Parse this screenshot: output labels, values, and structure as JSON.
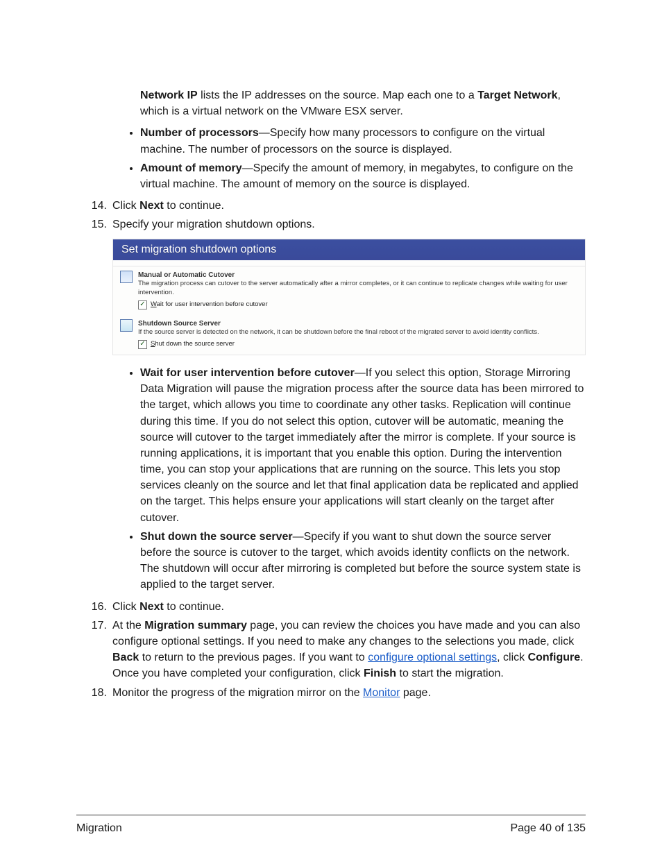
{
  "network_ip_para": {
    "b1": "Network IP",
    "t1": " lists the IP addresses on the source. Map each one to a ",
    "b2": "Target Network",
    "t2": ", which is a virtual network on the VMware ESX server."
  },
  "sub_bullets_top": {
    "nproc": {
      "b": "Number of processors",
      "t": "—Specify how many processors to configure on the virtual machine. The number of processors on the source is displayed."
    },
    "mem": {
      "b": "Amount of memory",
      "t": "—Specify the amount of memory, in megabytes, to configure on the virtual machine. The amount of memory on the source is displayed."
    }
  },
  "steps": {
    "s14": {
      "num": "14.",
      "pre": "Click ",
      "b": "Next",
      "post": " to continue."
    },
    "s15": {
      "num": "15.",
      "t": "Specify your migration shutdown options."
    },
    "s16": {
      "num": "16.",
      "pre": "Click ",
      "b": "Next",
      "post": " to continue."
    },
    "s17": {
      "num": "17.",
      "pre": "At the ",
      "b1": "Migration summary",
      "mid1": " page, you can review the choices you have made and you can also configure optional settings. If you need to make any changes to the selections you made, click ",
      "b2": "Back",
      "mid2": " to return to the previous pages. If you want to ",
      "link": "configure optional settings",
      "mid3": ", click ",
      "b3": "Configure",
      "mid4": ". Once you have completed your configuration, click ",
      "b4": "Finish",
      "post": " to start the migration."
    },
    "s18": {
      "num": "18.",
      "pre": "Monitor the progress of the migration mirror on the ",
      "link": "Monitor",
      "post": " page."
    }
  },
  "dialog": {
    "title": "Set migration shutdown options",
    "manual": {
      "h": "Manual or Automatic Cutover",
      "desc": "The migration process can cutover to the server automatically after a mirror completes, or it can continue to replicate changes while waiting for user intervention.",
      "chk_u": "W",
      "chk_rest": "ait for user intervention before cutover"
    },
    "shutdown": {
      "h": "Shutdown Source Server",
      "desc": "If the source server is detected on the network, it can be shutdown before the final reboot of the migrated server to avoid identity conflicts.",
      "chk_u": "S",
      "chk_rest": "hut down the source server"
    }
  },
  "sub_bullets_opts": {
    "wait": {
      "b": "Wait for user intervention before cutover",
      "t": "—If you select this option, Storage Mirroring Data Migration will pause the migration process after the source data has been mirrored to the target, which allows you time to coordinate any other tasks. Replication will continue during this time. If you do not select this option, cutover will be automatic, meaning the source will cutover to the target immediately after the mirror is complete. If your source is running applications, it is important that you enable this option. During the intervention time, you can stop your applications that are running on the source. This lets you stop services cleanly on the source and let that final application data be replicated and applied on the target. This helps ensure your applications will start cleanly on the target after cutover."
    },
    "shut": {
      "b": "Shut down the source server",
      "t": "—Specify if you want to shut down the source server before the source is cutover to the target, which avoids identity conflicts on the network. The shutdown will occur after mirroring is completed but before the source system state is applied to the target server."
    }
  },
  "footer": {
    "left": "Migration",
    "right": "Page 40 of 135"
  }
}
